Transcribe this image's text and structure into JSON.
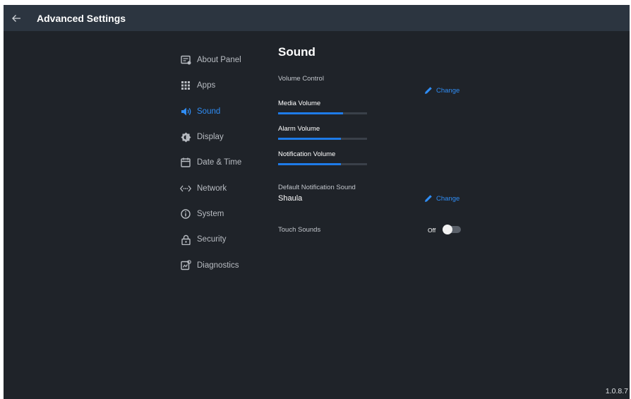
{
  "header": {
    "title": "Advanced Settings",
    "back_icon": "arrow-left-icon"
  },
  "nav": {
    "items": [
      {
        "label": "About Panel",
        "icon": "info-panel-icon",
        "active": false
      },
      {
        "label": "Apps",
        "icon": "grid-icon",
        "active": false
      },
      {
        "label": "Sound",
        "icon": "speaker-icon",
        "active": true
      },
      {
        "label": "Display",
        "icon": "brightness-icon",
        "active": false
      },
      {
        "label": "Date & Time",
        "icon": "calendar-icon",
        "active": false
      },
      {
        "label": "Network",
        "icon": "network-icon",
        "active": false
      },
      {
        "label": "System",
        "icon": "info-circle-icon",
        "active": false
      },
      {
        "label": "Security",
        "icon": "lock-icon",
        "active": false
      },
      {
        "label": "Diagnostics",
        "icon": "diagnostics-icon",
        "active": false
      }
    ]
  },
  "sound": {
    "title": "Sound",
    "volume_control_label": "Volume Control",
    "change_label": "Change",
    "media_volume": {
      "label": "Media Volume",
      "level": 0.73
    },
    "alarm_volume": {
      "label": "Alarm Volume",
      "level": 0.71
    },
    "notification_volume": {
      "label": "Notification Volume",
      "level": 0.71
    },
    "default_notification": {
      "label": "Default Notification Sound",
      "value": "Shaula",
      "change_label": "Change"
    },
    "touch_sounds": {
      "label": "Touch Sounds",
      "state": "Off",
      "enabled": false
    }
  },
  "footer": {
    "version": "1.0.8.7"
  },
  "colors": {
    "accent": "#2f8df5",
    "background": "#1f2329",
    "appbar": "#2c3540"
  }
}
